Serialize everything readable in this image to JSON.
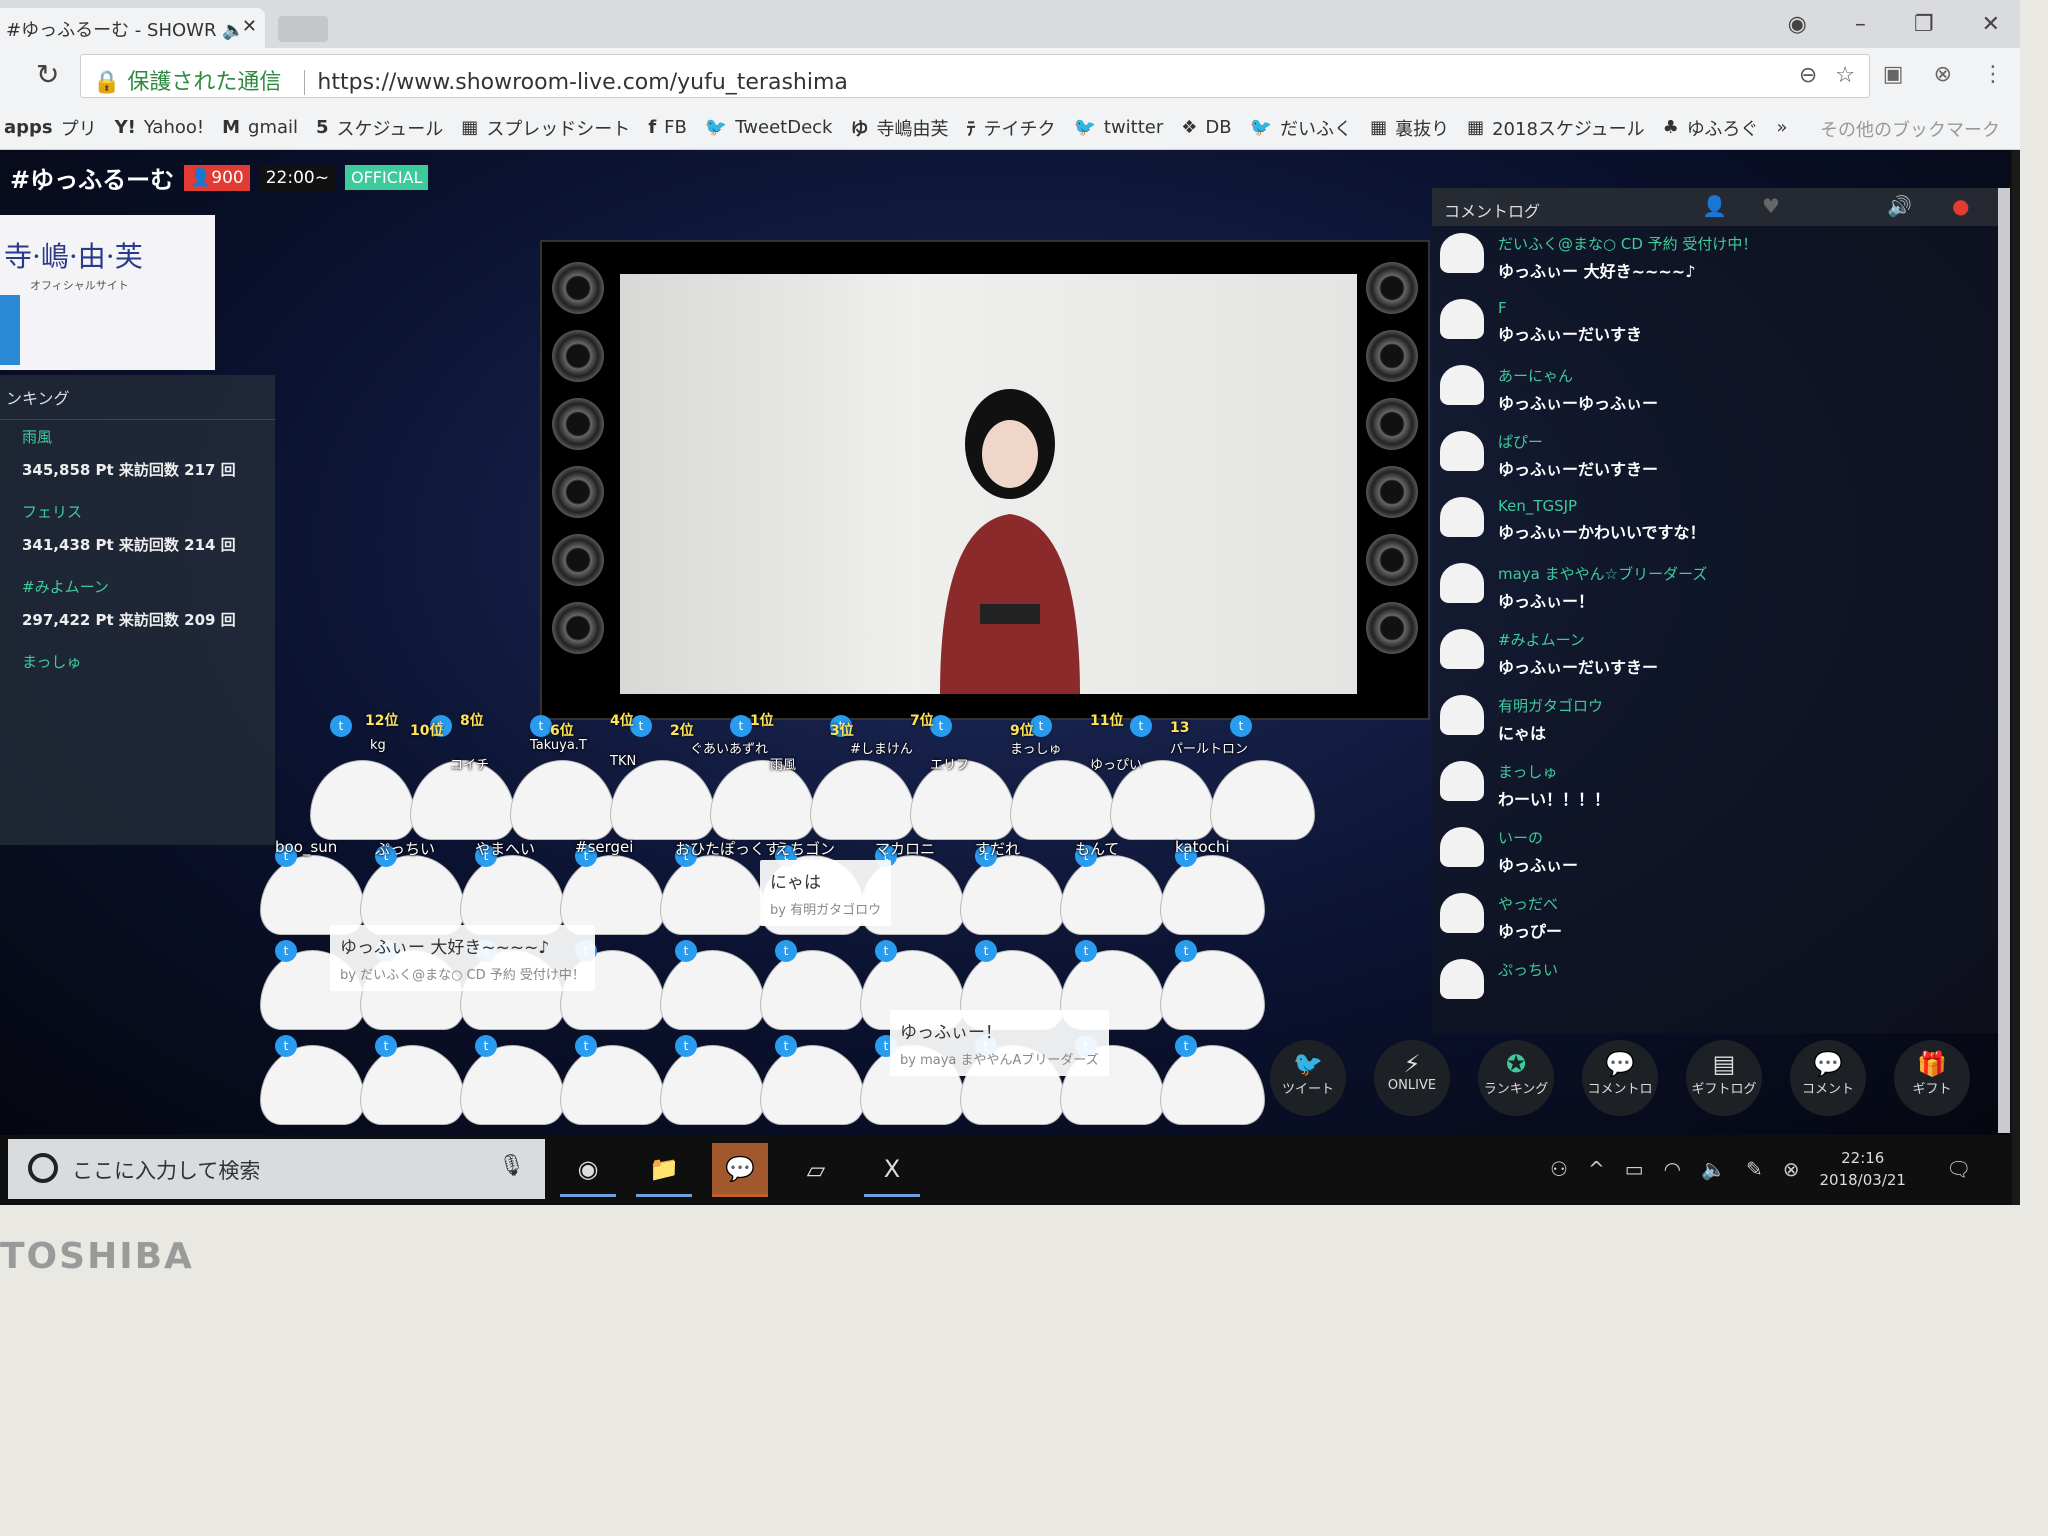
{
  "browser": {
    "tab_title": "#ゆっふるーむ - SHOWR",
    "secure_label": "保護された通信",
    "url": "https://www.showroom-live.com/yufu_terashima",
    "bookmarks": [
      "プリ",
      "Yahoo!",
      "gmail",
      "スケジュール",
      "スプレッドシート",
      "FB",
      "TweetDeck",
      "寺嶋由芙",
      "テイチク",
      "twitter",
      "DB",
      "だいふく",
      "裏抜り",
      "2018スケジュール",
      "ゆふろぐ"
    ],
    "bookmark_icons": [
      "apps",
      "Y!",
      "M",
      "5",
      "▦",
      "f",
      "🐦",
      "ゆ",
      "ﾃ",
      "🐦",
      "❖",
      "🐦",
      "▦",
      "▦",
      "♣"
    ],
    "overflow": "»",
    "other_bookmarks": "その他のブックマーク"
  },
  "room": {
    "title": "#ゆっふるーむ",
    "viewers": "900",
    "start_time": "22:00~",
    "badge": "OFFICIAL",
    "accent": "#3ecb9b"
  },
  "banner": {
    "name": "寺·嶋·由·芙",
    "sub": "オフィシャルサイト"
  },
  "ranking": {
    "title": "ンキング",
    "items": [
      {
        "name": "雨風",
        "points": "345,858 Pt 来訪回数 217 回"
      },
      {
        "name": "フェリス",
        "points": "341,438 Pt 来訪回数 214 回"
      },
      {
        "name": "#みよムーン",
        "points": "297,422 Pt 来訪回数 209 回"
      },
      {
        "name": "まっしゅ",
        "points": ""
      }
    ]
  },
  "stage": {
    "ranks": [
      "12位",
      "10位",
      "8位",
      "6位",
      "4位",
      "2位",
      "1位",
      "3位",
      "7位",
      "9位",
      "11位",
      "13"
    ],
    "front_names": [
      "kg",
      "コイチ",
      "Takuya.T",
      "TKN",
      "ぐあいあずれ",
      "雨風",
      "#しまけん",
      "エリフ",
      "まっしゅ",
      "ゆっぴい",
      "パールトロン"
    ],
    "row_names": [
      "boo_sun",
      "ぷっちい",
      "やまへい",
      "#sergei",
      "おひたぽっくす",
      "えちゴン",
      "マカロニ",
      "すだれ",
      "もんて",
      "katochi"
    ],
    "bubbles": [
      {
        "text": "にゃは",
        "by": "by 有明ガタゴロウ"
      },
      {
        "text": "ゆっふぃー 大好き~~~~♪",
        "by": "by だいふく@まな○ CD 予約 受付け中！"
      },
      {
        "text": "ゆっふぃー！",
        "by": "by maya まややんAブリーダーズ"
      }
    ]
  },
  "comment_log": {
    "title": "コメントログ",
    "comments": [
      {
        "user": "だいふく@まな○ CD 予約 受付け中！",
        "text": "ゆっふぃー 大好き~~~~♪"
      },
      {
        "user": "F",
        "text": "ゆっふぃーだいすき"
      },
      {
        "user": "あーにゃん",
        "text": "ゆっふぃーゆっふぃー"
      },
      {
        "user": "ぱぴー",
        "text": "ゆっふぃーだいすきー"
      },
      {
        "user": "Ken_TGSJP",
        "text": "ゆっふぃーかわいいですな！"
      },
      {
        "user": "maya まややん☆ブリーダーズ",
        "text": "ゆっふぃー！"
      },
      {
        "user": "#みよムーン",
        "text": "ゆっふぃーだいすきー"
      },
      {
        "user": "有明ガタゴロウ",
        "text": "にゃは"
      },
      {
        "user": "まっしゅ",
        "text": "わーい！！！！"
      },
      {
        "user": "いーの",
        "text": "ゆっふぃー"
      },
      {
        "user": "やっだべ",
        "text": "ゆっぴー"
      },
      {
        "user": "ぷっちい",
        "text": ""
      }
    ]
  },
  "actions": [
    {
      "label": "ツイート",
      "icon": "twitter"
    },
    {
      "label": "ONLIVE",
      "icon": "onlive"
    },
    {
      "label": "ランキング",
      "icon": "medal"
    },
    {
      "label": "コメントロ",
      "icon": "comment-log"
    },
    {
      "label": "ギフトログ",
      "icon": "gift-log"
    },
    {
      "label": "コメント",
      "icon": "comment"
    },
    {
      "label": "ギフト",
      "icon": "gift"
    }
  ],
  "taskbar": {
    "search_placeholder": "ここに入力して検索",
    "time": "22:16",
    "date": "2018/03/21"
  },
  "laptop": {
    "brand": "TOSHIBA"
  }
}
